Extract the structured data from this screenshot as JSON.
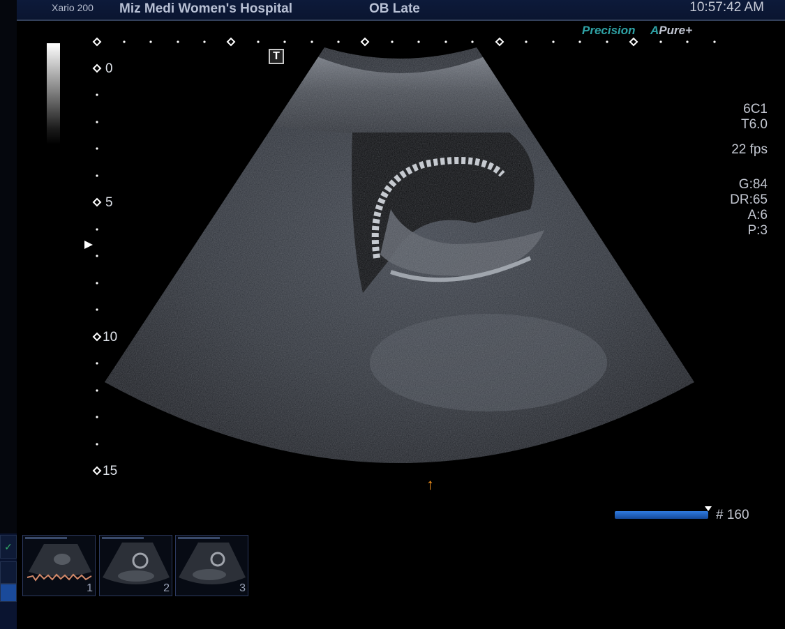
{
  "header": {
    "system": "Xario 200",
    "hospital": "Miz Medi Women's Hospital",
    "preset": "OB Late",
    "time": "10:57:42 AM"
  },
  "brand": {
    "precision": "Precision",
    "apure_a": "A",
    "apure_pure": "Pure",
    "apure_plus": "+"
  },
  "t_marker": "T",
  "params": {
    "probe": "6C1",
    "thi": "T6.0",
    "fps": "22 fps",
    "gain": "G:84",
    "dr": "DR:65",
    "a": "A:6",
    "p": "P:3"
  },
  "depth_scale": {
    "labels": [
      "0",
      "5",
      "10",
      "15"
    ]
  },
  "orange_arrow": "↑",
  "cine": {
    "frame": "# 160"
  },
  "thumbnails": [
    {
      "number": "1"
    },
    {
      "number": "2"
    },
    {
      "number": "3"
    }
  ],
  "colors": {
    "header_bg": "#0d1a3a",
    "brand_teal": "#2fa3a6",
    "cine_blue": "#2f7be0",
    "arrow_orange": "#ff9a1f"
  },
  "icons": {
    "check": "check-icon",
    "focus": "focus-triangle-icon"
  }
}
